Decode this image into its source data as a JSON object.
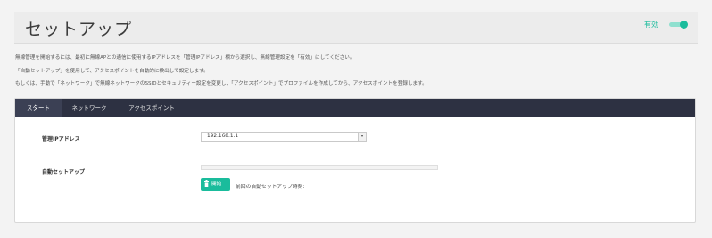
{
  "header": {
    "title": "セットアップ",
    "status_label": "有効"
  },
  "description": {
    "line1": "無線管理を開始するには、最初に無線APとの通信に使用するIPアドレスを「管理IPアドレス」欄から選択し、無線管理設定を「有効」にしてください。",
    "line2": "「自動セットアップ」を使用して、アクセスポイントを自動的に検出して設定します。",
    "line3": "もしくは、手動で「ネットワーク」で無線ネットワークのSSIDとセキュリティー設定を変更し、「アクセスポイント」でプロファイルを作成してから、アクセスポイントを登録します。"
  },
  "tabs": [
    {
      "label": "スタート"
    },
    {
      "label": "ネットワーク"
    },
    {
      "label": "アクセスポイント"
    }
  ],
  "form": {
    "mgmt_ip_label": "管理IPアドレス",
    "mgmt_ip_value": "192.168.1.1",
    "auto_setup_label": "自動セットアップ",
    "auto_setup_progress": 0,
    "start_button_label": "開始",
    "last_run_text": "前回の自動セットアップ時刻:"
  },
  "colors": {
    "accent": "#1abc9c",
    "tab_bar": "#2d3142",
    "tab_active": "#3b4054"
  },
  "icons": {
    "start_button_icon": "trash-icon",
    "select_icon": "chevron-down-icon"
  }
}
